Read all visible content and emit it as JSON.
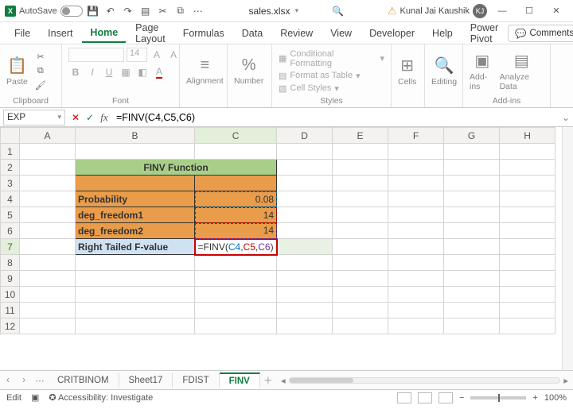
{
  "titlebar": {
    "autosave_label": "AutoSave",
    "filename": "sales.xlsx",
    "user_name": "Kunal Jai Kaushik",
    "user_initials": "KJ"
  },
  "menu": {
    "file": "File",
    "insert": "Insert",
    "home": "Home",
    "page_layout": "Page Layout",
    "formulas": "Formulas",
    "data": "Data",
    "review": "Review",
    "view": "View",
    "developer": "Developer",
    "help": "Help",
    "power_pivot": "Power Pivot",
    "comments": "Comments"
  },
  "ribbon": {
    "paste": "Paste",
    "clipboard": "Clipboard",
    "font_size_placeholder": "14",
    "font": "Font",
    "alignment": "Alignment",
    "number": "Number",
    "cond_fmt": "Conditional Formatting",
    "as_table": "Format as Table",
    "cell_styles": "Cell Styles",
    "styles": "Styles",
    "cells": "Cells",
    "editing": "Editing",
    "addins": "Add-ins",
    "analyze": "Analyze Data",
    "addins_grp": "Add-ins"
  },
  "formula_bar": {
    "name": "EXP",
    "formula": "=FINV(C4,C5,C6)"
  },
  "columns": [
    "A",
    "B",
    "C",
    "D",
    "E",
    "F",
    "G",
    "H"
  ],
  "rows": [
    "1",
    "2",
    "3",
    "4",
    "5",
    "6",
    "7",
    "8",
    "9",
    "10",
    "11",
    "12"
  ],
  "cells": {
    "title": "FINV Function",
    "b4": "Probability",
    "c4": "0.08",
    "b5": "deg_freedom1",
    "c5": "14",
    "b6": "deg_freedom2",
    "c6": "14",
    "b7": "Right Tailed F-value",
    "c7_pre": "=FINV(",
    "c7_a1": "C4",
    "c7_a2": "C5",
    "c7_a3": "C6",
    "c7_post": ")"
  },
  "sheets": {
    "s1": "CRITBINOM",
    "s2": "Sheet17",
    "s3": "FDIST",
    "s4": "FINV"
  },
  "status": {
    "mode": "Edit",
    "access": "Accessibility: Investigate",
    "zoom": "100%"
  }
}
